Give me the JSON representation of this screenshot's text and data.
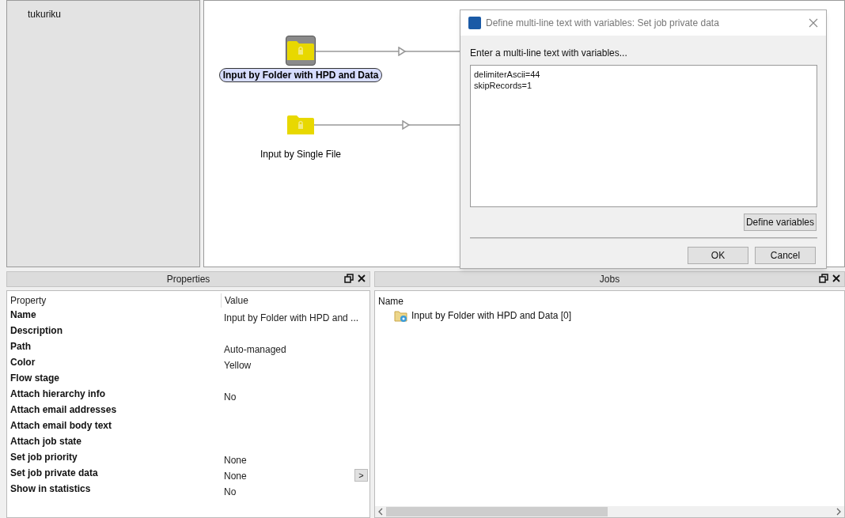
{
  "sidebar": {
    "items": [
      "tukuriku"
    ]
  },
  "canvas": {
    "nodes": [
      {
        "label": "Input by Folder with HPD and Data",
        "selected": true
      },
      {
        "label": "Input by Single File",
        "selected": false
      }
    ]
  },
  "dialog": {
    "title": "Define multi-line text with variables: Set job private data",
    "prompt": "Enter a multi-line text with variables...",
    "value": "delimiterAscii=44\nskipRecords=1",
    "buttons": {
      "define": "Define variables",
      "ok": "OK",
      "cancel": "Cancel"
    }
  },
  "properties": {
    "title": "Properties",
    "columns": [
      "Property",
      "Value"
    ],
    "rows": [
      {
        "name": "Name",
        "value": "Input by Folder with HPD and ..."
      },
      {
        "name": "Description",
        "value": ""
      },
      {
        "name": "Path",
        "value": "Auto-managed"
      },
      {
        "name": "Color",
        "value": "Yellow"
      },
      {
        "name": "Flow stage",
        "value": ""
      },
      {
        "name": "Attach hierarchy info",
        "value": "No"
      },
      {
        "name": "Attach email addresses",
        "value": ""
      },
      {
        "name": "Attach email body text",
        "value": ""
      },
      {
        "name": "Attach job state",
        "value": ""
      },
      {
        "name": "Set job priority",
        "value": "None"
      },
      {
        "name": "Set job private data",
        "value": "None",
        "action": ">"
      },
      {
        "name": "Show in statistics",
        "value": "No"
      }
    ]
  },
  "jobs": {
    "title": "Jobs",
    "columns": [
      "Name"
    ],
    "items": [
      "Input by Folder with HPD and Data [0]"
    ]
  }
}
